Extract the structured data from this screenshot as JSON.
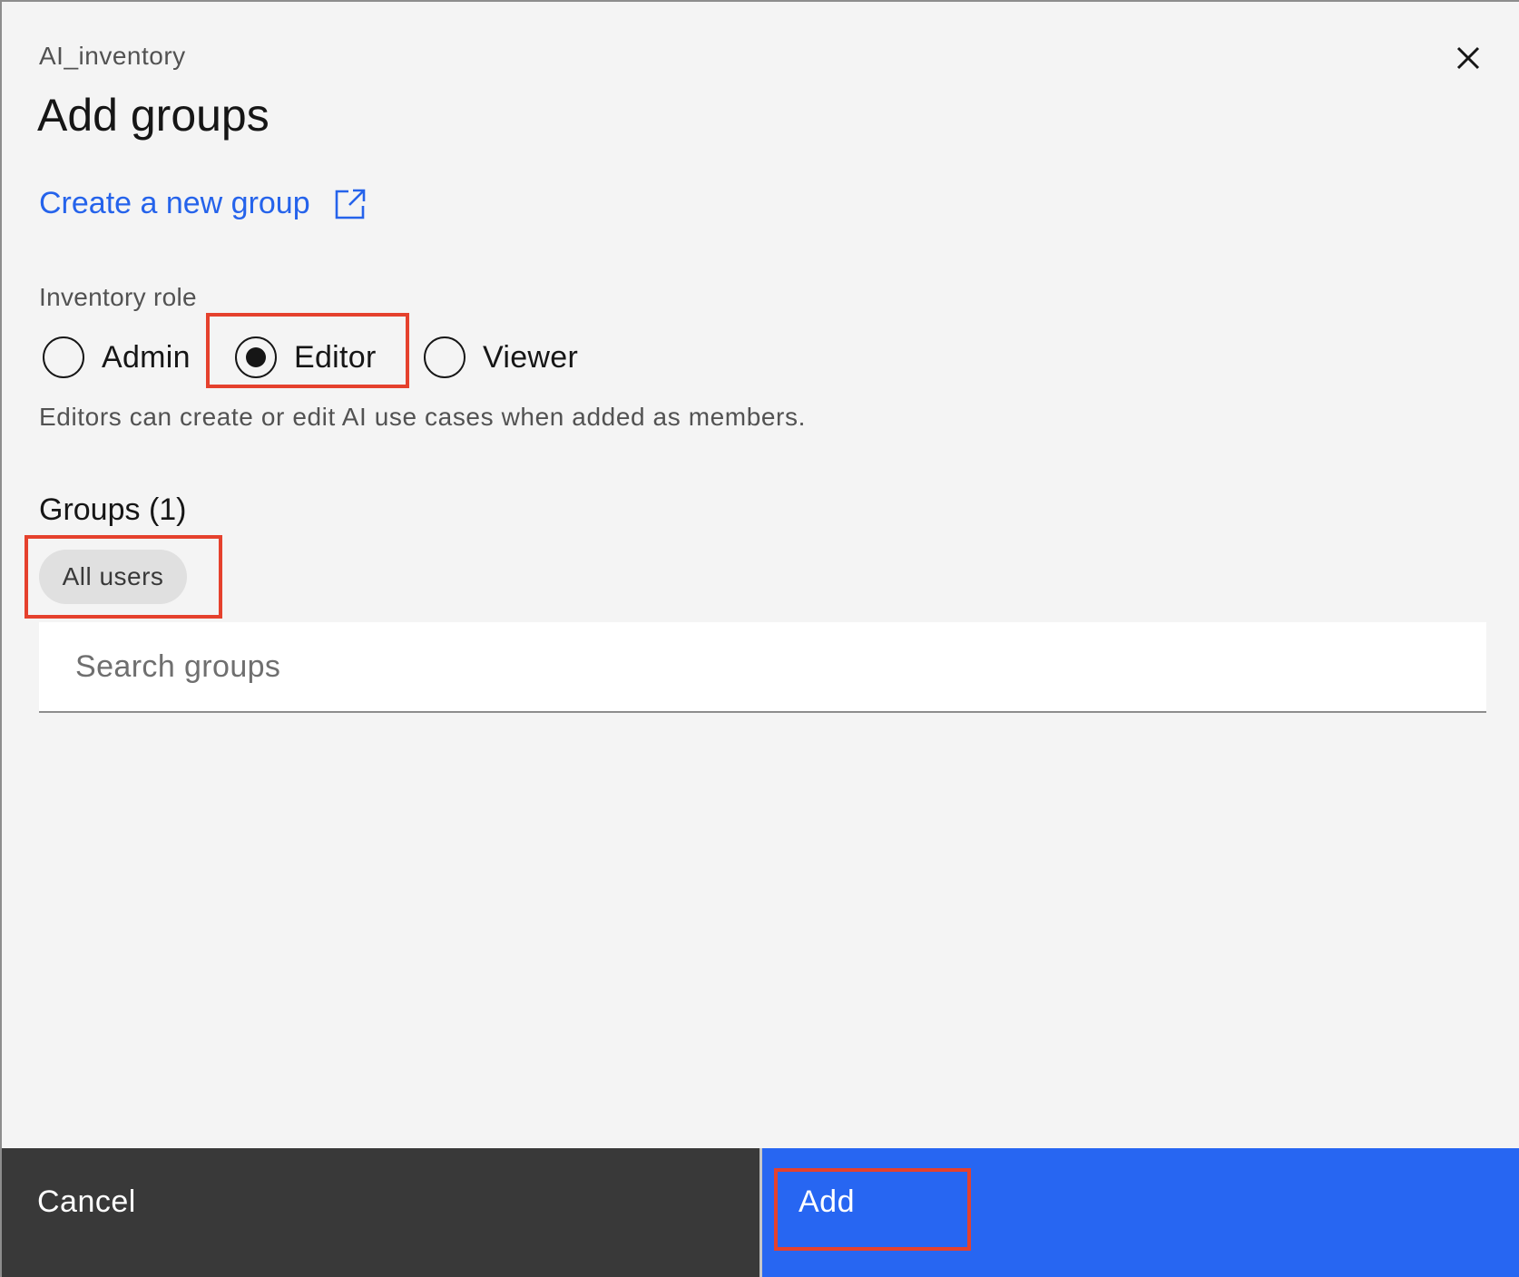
{
  "modal": {
    "inventory_name": "AI_inventory",
    "title": "Add groups",
    "close_icon": "close-icon"
  },
  "create_link": {
    "label": "Create a new group",
    "icon": "external-link-icon",
    "color": "#2563eb"
  },
  "role": {
    "label": "Inventory role",
    "options": [
      {
        "label": "Admin",
        "selected": false
      },
      {
        "label": "Editor",
        "selected": true
      },
      {
        "label": "Viewer",
        "selected": false
      }
    ],
    "helper_text": "Editors can create or edit AI use cases when added as members."
  },
  "groups": {
    "heading": "Groups (1)",
    "selected_tags": [
      "All users"
    ],
    "search_placeholder": "Search groups",
    "search_value": ""
  },
  "footer": {
    "cancel_label": "Cancel",
    "add_label": "Add",
    "primary_color": "#2766f2",
    "secondary_color": "#393939"
  },
  "annotations": {
    "highlight_color": "#e5412d",
    "highlighted": [
      "Editor",
      "All users",
      "Add"
    ]
  }
}
